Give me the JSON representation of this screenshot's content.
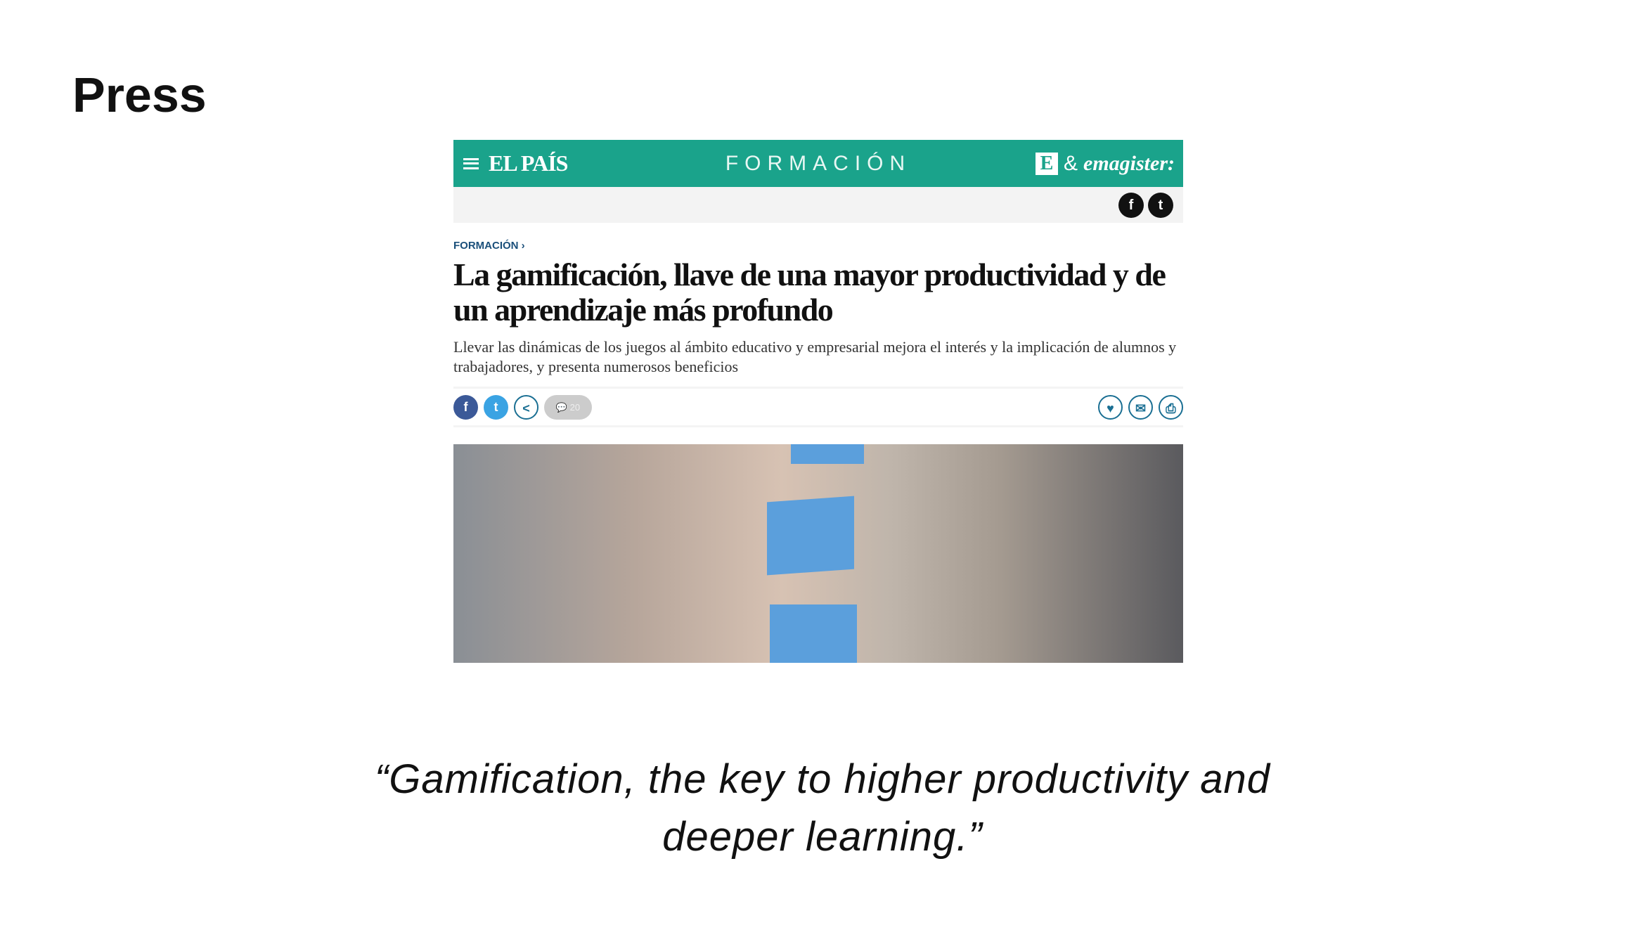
{
  "slide": {
    "title": "Press",
    "quote_line1": "“Gamification, the key to higher productivity and",
    "quote_line2": "deeper learning.”"
  },
  "article": {
    "header": {
      "logo": "EL PAÍS",
      "section": "FORMACIÓN",
      "partner_e": "E",
      "partner_amp": "&",
      "partner_name": "emagister:",
      "color": "#1aa38b"
    },
    "social_top": {
      "facebook": "f",
      "twitter": "t"
    },
    "breadcrumb": "FORMACIÓN ›",
    "headline": "La gamificación, llave de una mayor productividad y de un aprendizaje más profundo",
    "subheadline": "Llevar las dinámicas de los juegos al ámbito educativo y empresarial mejora el interés y la implicación de alumnos y trabajadores, y presenta numerosos beneficios",
    "share": {
      "facebook": "f",
      "twitter": "t",
      "share": "<",
      "comments": "20"
    },
    "actions": {
      "like": "♥",
      "email": "✉",
      "print": "⎙"
    }
  }
}
